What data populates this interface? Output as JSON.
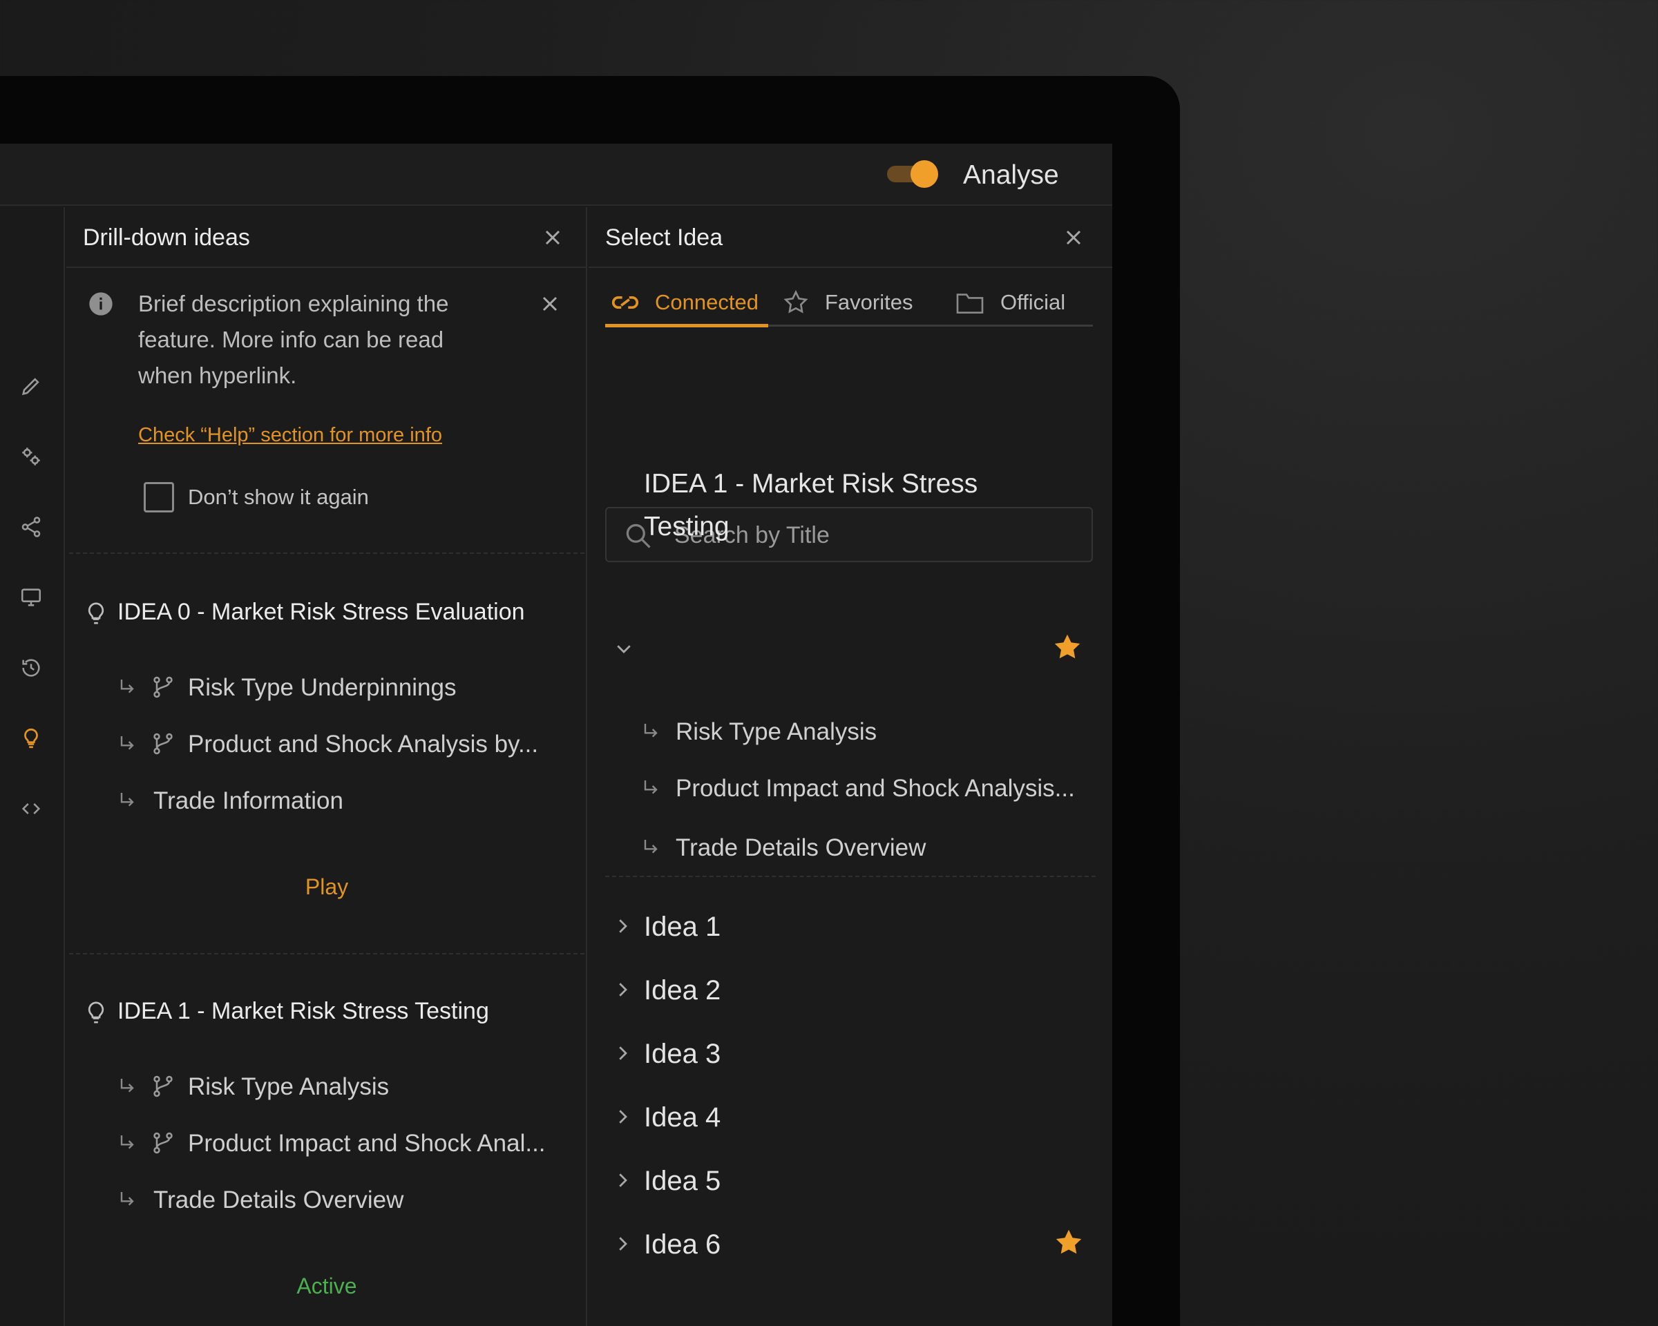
{
  "topbar": {
    "toggle_label": "Analyse"
  },
  "drill": {
    "title": "Drill-down ideas",
    "info_text": "Brief description explaining the feature. More info can be read when hyperlink.",
    "help_link": "Check “Help” section for more info",
    "dont_show": "Don’t show it again",
    "ideas": [
      {
        "title": "IDEA 0 - Market Risk Stress Evaluation",
        "items": [
          "Risk Type Underpinnings",
          "Product and Shock Analysis by...",
          "Trade Information"
        ],
        "status": "Play"
      },
      {
        "title": "IDEA 1 - Market Risk Stress Testing",
        "items": [
          "Risk Type Analysis",
          "Product Impact and Shock Anal...",
          "Trade Details Overview"
        ],
        "status": "Active"
      }
    ]
  },
  "select": {
    "title": "Select Idea",
    "tabs": [
      {
        "label": "Connected",
        "icon": "link-icon"
      },
      {
        "label": "Favorites",
        "icon": "star-outline-icon"
      },
      {
        "label": "Official",
        "icon": "folder-icon"
      }
    ],
    "search_placeholder": "Search by Title",
    "expanded": {
      "title": "IDEA 1 - Market Risk Stress Testing",
      "items": [
        "Risk Type Analysis",
        "Product Impact and Shock Analysis...",
        "Trade Details Overview"
      ]
    },
    "list": [
      "Idea 1",
      "Idea 2",
      "Idea 3",
      "Idea 4",
      "Idea 5",
      "Idea 6"
    ]
  },
  "colors": {
    "accent": "#e2941f",
    "active": "#4caf50",
    "star": "#f0a02a"
  }
}
